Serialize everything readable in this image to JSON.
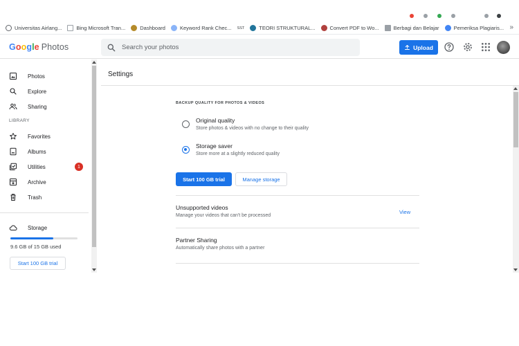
{
  "bookmarks": [
    {
      "label": "Universitas Airlang...",
      "color": "#5f6368"
    },
    {
      "label": "Bing Microsoft Tran...",
      "color": "#9aa0a6"
    },
    {
      "label": "Dashboard",
      "color": "#b58b2a"
    },
    {
      "label": "Keyword Rank Chec...",
      "color": "#8ab4f8"
    },
    {
      "label": "SST",
      "color": "#ffffff"
    },
    {
      "label": "TEORI STRUKTURAL...",
      "color": "#21759b"
    },
    {
      "label": "Convert PDF to Wo...",
      "color": "#b0413e"
    },
    {
      "label": "Berbagi dan Belajar",
      "color": "#9aa0a6"
    },
    {
      "label": "Pemeriksa Plagiaris...",
      "color": "#4285f4"
    }
  ],
  "bookmarks_more": "»",
  "header": {
    "logo_google": "Google",
    "logo_product": "Photos",
    "search_placeholder": "Search your photos",
    "upload_label": "Upload"
  },
  "sidebar": {
    "items": [
      {
        "label": "Photos",
        "icon": "photo-icon"
      },
      {
        "label": "Explore",
        "icon": "search-icon"
      },
      {
        "label": "Sharing",
        "icon": "people-icon"
      }
    ],
    "library_label": "LIBRARY",
    "library_items": [
      {
        "label": "Favorites",
        "icon": "star-icon"
      },
      {
        "label": "Albums",
        "icon": "album-icon"
      },
      {
        "label": "Utilities",
        "icon": "utilities-icon",
        "badge": "1"
      },
      {
        "label": "Archive",
        "icon": "archive-icon"
      },
      {
        "label": "Trash",
        "icon": "trash-icon"
      }
    ],
    "storage_label": "Storage",
    "storage_used_fraction": 0.64,
    "storage_text": "9.6 GB of 15 GB used",
    "trial_button": "Start 100 GB trial"
  },
  "settings": {
    "title": "Settings",
    "backup_label": "BACKUP QUALITY FOR PHOTOS & VIDEOS",
    "options": [
      {
        "title": "Original quality",
        "desc": "Store photos & videos with no change to their quality",
        "selected": false
      },
      {
        "title": "Storage saver",
        "desc": "Store more at a slightly reduced quality",
        "selected": true
      }
    ],
    "trial_button": "Start 100 GB trial",
    "manage_button": "Manage storage",
    "unsupported": {
      "title": "Unsupported videos",
      "desc": "Manage your videos that can't be processed",
      "link": "View"
    },
    "partner": {
      "title": "Partner Sharing",
      "desc": "Automatically share photos with a partner"
    }
  },
  "colors": {
    "accent": "#1a73e8",
    "badge": "#d93025"
  }
}
